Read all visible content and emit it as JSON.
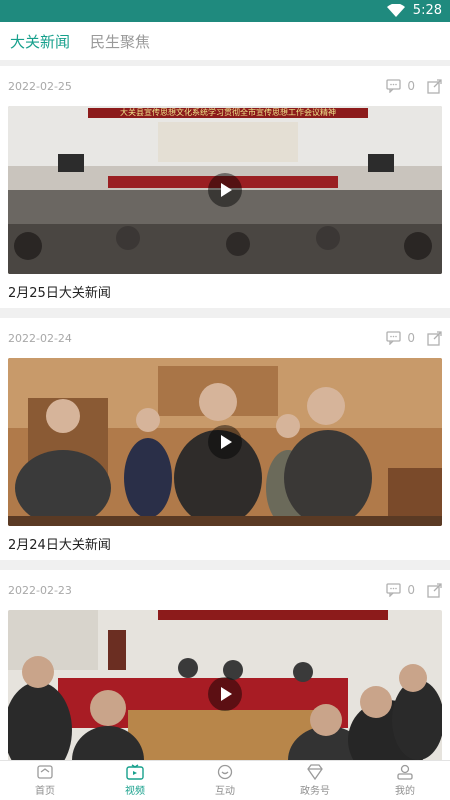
{
  "status_bar": {
    "time": "5:28"
  },
  "tabs": [
    {
      "label": "大关新闻",
      "active": true
    },
    {
      "label": "民生聚焦",
      "active": false
    }
  ],
  "feed": [
    {
      "date": "2022-02-25",
      "comments": "0",
      "title": "2月25日大关新闻",
      "banner_text": "大关县宣传思想文化系统学习贯彻全市宣传思想工作会议精神"
    },
    {
      "date": "2022-02-24",
      "comments": "0",
      "title": "2月24日大关新闻"
    },
    {
      "date": "2022-02-23",
      "comments": "0",
      "title": ""
    }
  ],
  "bottom_nav": [
    {
      "label": "首页",
      "icon": "home-icon",
      "active": false
    },
    {
      "label": "视频",
      "icon": "tv-icon",
      "active": true
    },
    {
      "label": "互动",
      "icon": "chat-icon",
      "active": false
    },
    {
      "label": "政务号",
      "icon": "diamond-icon",
      "active": false
    },
    {
      "label": "我的",
      "icon": "user-icon",
      "active": false
    }
  ],
  "colors": {
    "accent": "#17a08c",
    "status_bar": "#1f8a7e"
  }
}
